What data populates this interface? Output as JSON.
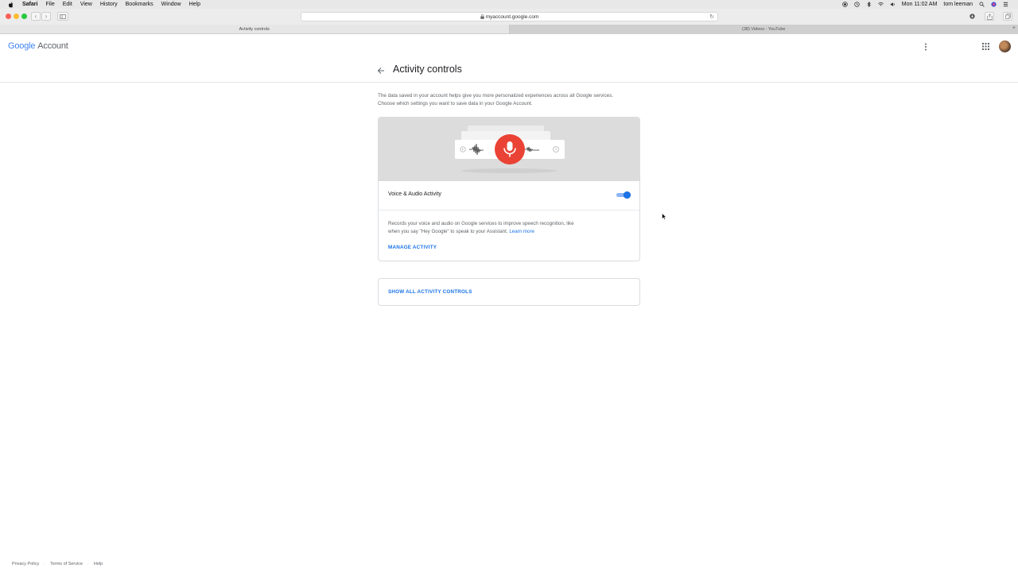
{
  "menubar": {
    "app": "Safari",
    "items": [
      "File",
      "Edit",
      "View",
      "History",
      "Bookmarks",
      "Window",
      "Help"
    ],
    "clock": "Mon 11:02 AM",
    "user": "tom leeman"
  },
  "browser": {
    "url": "myaccount.google.com",
    "tabs": [
      {
        "label": "Activity controls",
        "active": true
      },
      {
        "label": "(38) Videos - YouTube",
        "active": false
      }
    ]
  },
  "header": {
    "logo_google": "Google",
    "logo_account": "Account"
  },
  "page": {
    "title": "Activity controls",
    "description_line1": "The data saved in your account helps give you more personalized experiences across all Google services.",
    "description_line2": "Choose which settings you want to save data in your Google Account."
  },
  "setting": {
    "label": "Voice & Audio Activity",
    "enabled": true,
    "description_line1": "Records your voice and audio on Google services to improve speech recognition, like",
    "description_line2": "when you say \"Hey Google\" to speak to your Assistant.",
    "learn_more": "Learn more",
    "manage_label": "MANAGE ACTIVITY"
  },
  "show_all_label": "SHOW ALL ACTIVITY CONTROLS",
  "footer": {
    "links": [
      "Privacy Policy",
      "Terms of Service",
      "Help"
    ],
    "separator": "·"
  },
  "colors": {
    "accent": "#1a73e8",
    "mic_red": "#ea4335"
  }
}
